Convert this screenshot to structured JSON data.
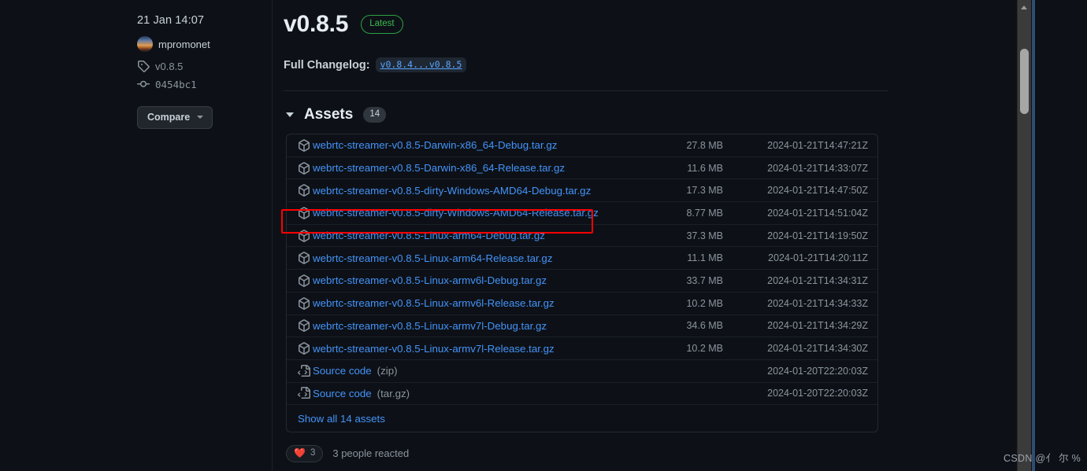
{
  "meta": {
    "date": "21 Jan 14:07",
    "author": "mpromonet",
    "tag": "v0.8.5",
    "commit": "0454bc1",
    "compare_label": "Compare",
    "tag_icon": "tag-icon",
    "commit_icon": "commit-icon",
    "avatar_icon": "avatar"
  },
  "release": {
    "title": "v0.8.5",
    "latest_badge": "Latest",
    "changelog_label": "Full Changelog:",
    "changelog_link": "v0.8.4...v0.8.5"
  },
  "assets": {
    "title": "Assets",
    "count": "14",
    "show_all_label": "Show all 14 assets",
    "rows": [
      {
        "name": "webrtc-streamer-v0.8.5-Darwin-x86_64-Debug.tar.gz",
        "suffix": "",
        "size": "27.8 MB",
        "date": "2024-01-21T14:47:21Z",
        "icon": "package-icon",
        "highlighted": false
      },
      {
        "name": "webrtc-streamer-v0.8.5-Darwin-x86_64-Release.tar.gz",
        "suffix": "",
        "size": "11.6 MB",
        "date": "2024-01-21T14:33:07Z",
        "icon": "package-icon",
        "highlighted": false
      },
      {
        "name": "webrtc-streamer-v0.8.5-dirty-Windows-AMD64-Debug.tar.gz",
        "suffix": "",
        "size": "17.3 MB",
        "date": "2024-01-21T14:47:50Z",
        "icon": "package-icon",
        "highlighted": false
      },
      {
        "name": "webrtc-streamer-v0.8.5-dirty-Windows-AMD64-Release.tar.gz",
        "suffix": "",
        "size": "8.77 MB",
        "date": "2024-01-21T14:51:04Z",
        "icon": "package-icon",
        "highlighted": true
      },
      {
        "name": "webrtc-streamer-v0.8.5-Linux-arm64-Debug.tar.gz",
        "suffix": "",
        "size": "37.3 MB",
        "date": "2024-01-21T14:19:50Z",
        "icon": "package-icon",
        "highlighted": false
      },
      {
        "name": "webrtc-streamer-v0.8.5-Linux-arm64-Release.tar.gz",
        "suffix": "",
        "size": "11.1 MB",
        "date": "2024-01-21T14:20:11Z",
        "icon": "package-icon",
        "highlighted": false
      },
      {
        "name": "webrtc-streamer-v0.8.5-Linux-armv6l-Debug.tar.gz",
        "suffix": "",
        "size": "33.7 MB",
        "date": "2024-01-21T14:34:31Z",
        "icon": "package-icon",
        "highlighted": false
      },
      {
        "name": "webrtc-streamer-v0.8.5-Linux-armv6l-Release.tar.gz",
        "suffix": "",
        "size": "10.2 MB",
        "date": "2024-01-21T14:34:33Z",
        "icon": "package-icon",
        "highlighted": false
      },
      {
        "name": "webrtc-streamer-v0.8.5-Linux-armv7l-Debug.tar.gz",
        "suffix": "",
        "size": "34.6 MB",
        "date": "2024-01-21T14:34:29Z",
        "icon": "package-icon",
        "highlighted": false
      },
      {
        "name": "webrtc-streamer-v0.8.5-Linux-armv7l-Release.tar.gz",
        "suffix": "",
        "size": "10.2 MB",
        "date": "2024-01-21T14:34:30Z",
        "icon": "package-icon",
        "highlighted": false
      },
      {
        "name": "Source code",
        "suffix": "(zip)",
        "size": "",
        "date": "2024-01-20T22:20:03Z",
        "icon": "file-code-icon",
        "highlighted": false
      },
      {
        "name": "Source code",
        "suffix": "(tar.gz)",
        "size": "",
        "date": "2024-01-20T22:20:03Z",
        "icon": "file-code-icon",
        "highlighted": false
      }
    ]
  },
  "reactions": {
    "emoji": "❤️",
    "count": "3",
    "text": "3 people reacted"
  },
  "watermark": "CSDN @亻 尔 %",
  "colors": {
    "background": "#0d1117",
    "link": "#4493f8",
    "muted": "#8b949e",
    "latest_green": "#3fb950",
    "highlight_red": "#ff0000",
    "scrollbar": "#a6a6a6"
  }
}
